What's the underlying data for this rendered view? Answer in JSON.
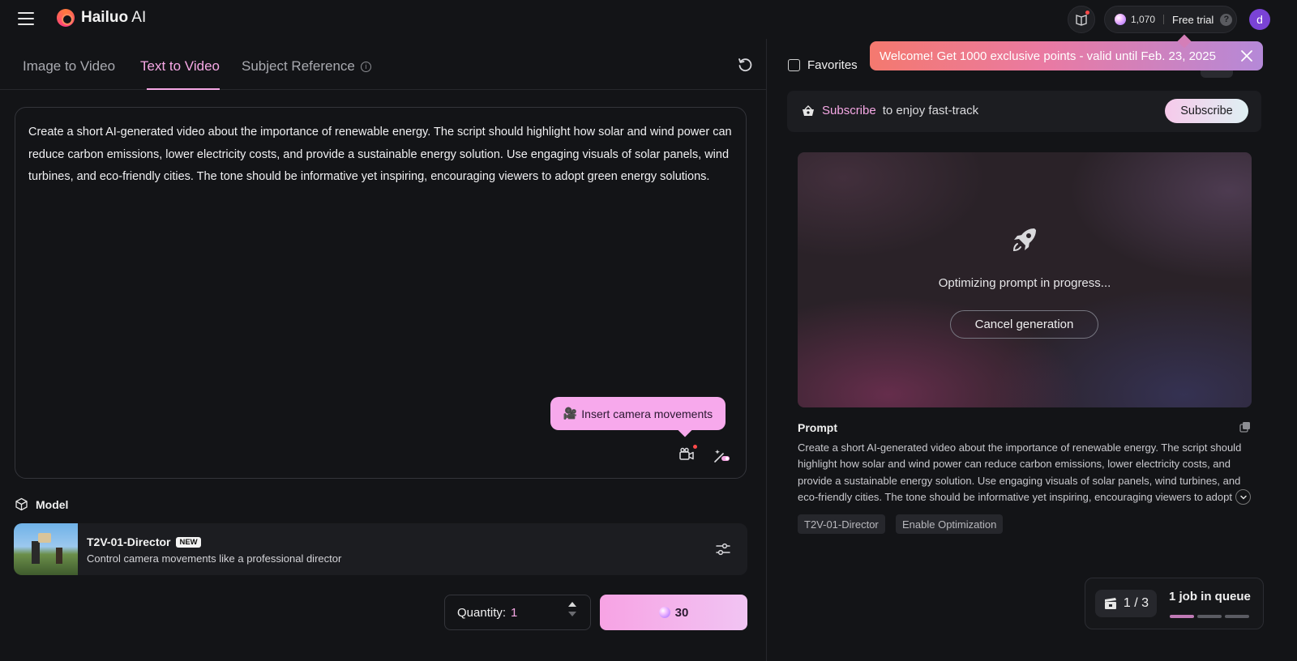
{
  "header": {
    "brand_bold": "Hailuo",
    "brand_light": " AI",
    "points": "1,070",
    "trial_label": "Free trial",
    "help_glyph": "?",
    "avatar_letter": "d"
  },
  "tabs": [
    {
      "label": "Image to Video"
    },
    {
      "label": "Text to Video",
      "active": true
    },
    {
      "label": "Subject Reference"
    }
  ],
  "editor": {
    "prompt": "Create a short AI-generated video about the importance of renewable energy. The script should highlight how solar and wind power can reduce carbon emissions, lower electricity costs, and provide a sustainable energy solution. Use engaging visuals of solar panels, wind turbines, and eco-friendly cities. The tone should be informative yet inspiring, encouraging viewers to adopt green energy solutions.",
    "tooltip": "Insert camera movements"
  },
  "model": {
    "section_label": "Model",
    "name": "T2V-01-Director",
    "badge": "NEW",
    "description": "Control camera movements like a professional director"
  },
  "quantity": {
    "label": "Quantity:",
    "value": "1"
  },
  "generate": {
    "cost": "30"
  },
  "right": {
    "favorites_label": "Favorites",
    "toast": "Welcome! Get 1000 exclusive points - valid until Feb. 23, 2025",
    "subscribe": {
      "highlight": "Subscribe",
      "rest": "to enjoy fast-track",
      "button": "Subscribe"
    },
    "status_text": "Optimizing prompt in progress...",
    "cancel_button": "Cancel generation",
    "prompt_label": "Prompt",
    "prompt_text": "Create a short AI-generated video about the importance of renewable energy. The script should highlight how solar and wind power can reduce carbon emissions, lower electricity costs, and provide a sustainable energy solution. Use engaging visuals of solar panels, wind turbines, and eco-friendly cities. The tone should be informative yet inspiring, encouraging viewers to adopt green energy solutions.",
    "tags": [
      "T2V-01-Director",
      "Enable Optimization"
    ],
    "queue": {
      "count": "1 / 3",
      "text": "1 job in queue"
    }
  },
  "colors": {
    "accent_pink": "#f6a8e5",
    "background": "#131417",
    "card": "#1c1d21"
  }
}
